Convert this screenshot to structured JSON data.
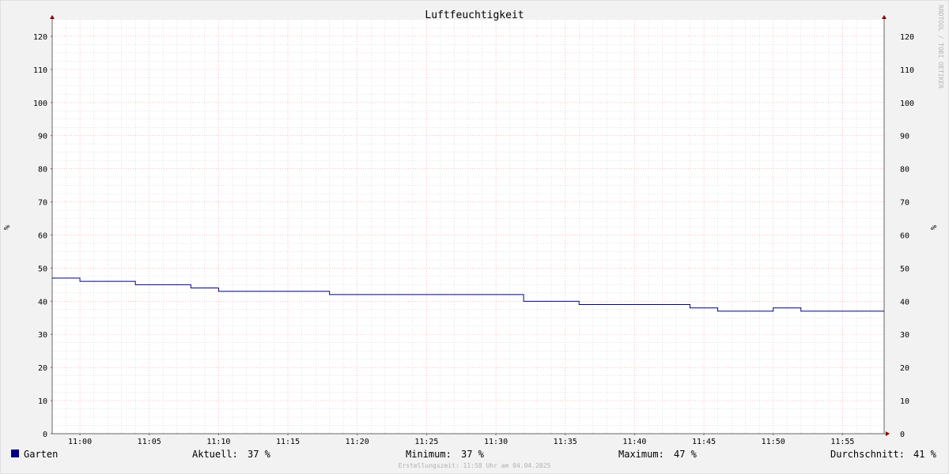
{
  "colors": {
    "canvas": "#f2f2f2",
    "plot_bg": "#ffffff",
    "line": "#000080",
    "major_grid": "#ff9a9a",
    "minor_grid": "#c8c8c8",
    "axis": "#666666",
    "arrow": "#8b0000"
  },
  "chart_data": {
    "type": "line",
    "title": "Luftfeuchtigkeit",
    "ylabel": "%",
    "ylabel_right": "%",
    "ylim": [
      0,
      125
    ],
    "y_ticks": [
      0,
      10,
      20,
      30,
      40,
      50,
      60,
      70,
      80,
      90,
      100,
      110,
      120
    ],
    "y_tick_labels": [
      "0",
      "10",
      "20",
      "30",
      "40",
      "50",
      "60",
      "70",
      "80",
      "90",
      "100",
      "110",
      "120"
    ],
    "x_unit": "minutes",
    "xlim": [
      "10:58",
      "11:58"
    ],
    "x_ticks": [
      "11:00",
      "11:05",
      "11:10",
      "11:15",
      "11:20",
      "11:25",
      "11:30",
      "11:35",
      "11:40",
      "11:45",
      "11:50",
      "11:55"
    ],
    "grid": true,
    "series": [
      {
        "name": "Garten",
        "color": "#000080",
        "step": true,
        "points": [
          [
            "10:58",
            47
          ],
          [
            "11:00",
            46
          ],
          [
            "11:04",
            45
          ],
          [
            "11:08",
            44
          ],
          [
            "11:10",
            43
          ],
          [
            "11:18",
            42
          ],
          [
            "11:32",
            40
          ],
          [
            "11:36",
            39
          ],
          [
            "11:44",
            38
          ],
          [
            "11:46",
            37
          ],
          [
            "11:50",
            38
          ],
          [
            "11:52",
            37
          ],
          [
            "11:58",
            37
          ]
        ]
      }
    ]
  },
  "legend": {
    "series_name": "Garten",
    "current_label": "Aktuell:",
    "current_value": "37 %",
    "min_label": "Minimum:",
    "min_value": "37 %",
    "max_label": "Maximum:",
    "max_value": "47 %",
    "avg_label": "Durchschnitt:",
    "avg_value": "41 %"
  },
  "side_text": "RRDTOOL / TOBI OETIKER",
  "footer": "Erstellungszeit: 11:58 Uhr am 04.04.2025"
}
